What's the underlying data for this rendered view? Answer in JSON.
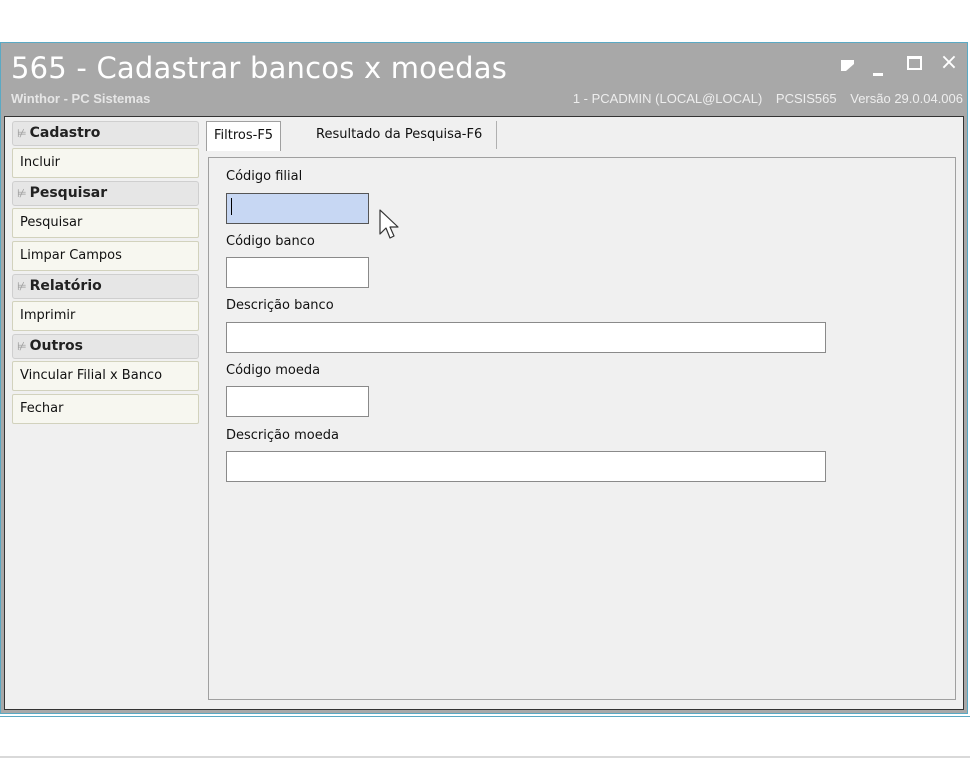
{
  "window": {
    "title": "565 - Cadastrar bancos x moedas",
    "subtitle": "Winthor - PC Sistemas",
    "session": "1 - PCADMIN (LOCAL@LOCAL)",
    "routine": "PCSIS565",
    "version": "Versão  29.0.04.006",
    "controls": {
      "restore": "restore-icon",
      "minimize": "minimize-icon",
      "maximize": "maximize-icon",
      "close": "×"
    }
  },
  "sidebar": {
    "groups": [
      {
        "label": "Cadastro",
        "items": [
          "Incluir"
        ]
      },
      {
        "label": "Pesquisar",
        "items": [
          "Pesquisar",
          "Limpar Campos"
        ]
      },
      {
        "label": "Relatório",
        "items": [
          "Imprimir"
        ]
      },
      {
        "label": "Outros",
        "items": [
          "Vincular Filial x Banco",
          "Fechar"
        ]
      }
    ],
    "chevron_icon": "double-chevron-down-icon"
  },
  "tabs": [
    {
      "label": "Filtros-F5",
      "active": true
    },
    {
      "label": "Resultado da Pesquisa-F6",
      "active": false
    }
  ],
  "form": {
    "codigo_filial": {
      "label": "Código filial",
      "value": ""
    },
    "codigo_banco": {
      "label": "Código banco",
      "value": ""
    },
    "descricao_banco": {
      "label": "Descrição banco",
      "value": ""
    },
    "codigo_moeda": {
      "label": "Código moeda",
      "value": ""
    },
    "descricao_moeda": {
      "label": "Descrição moeda",
      "value": ""
    }
  },
  "colors": {
    "title_bar": "#a8a8a8",
    "focused_input": "#c7d7f3",
    "window_border": "#5aa9c4"
  }
}
